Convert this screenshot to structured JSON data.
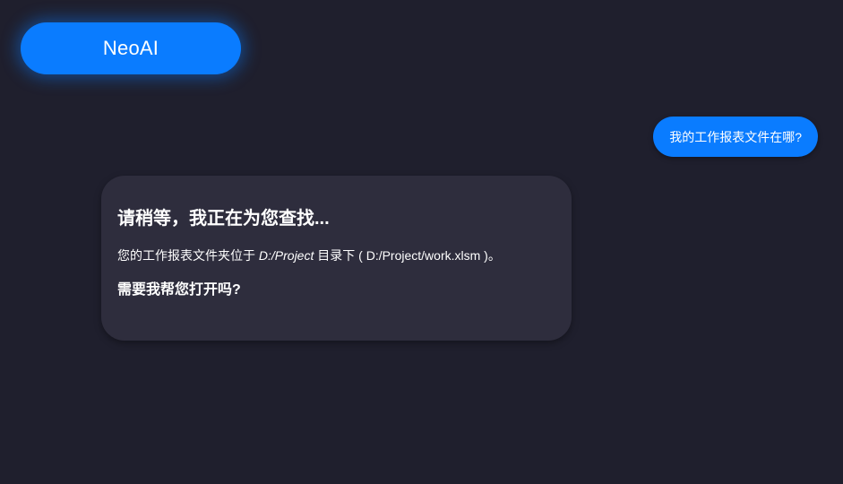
{
  "app": {
    "brand_button_label": "NeoAI"
  },
  "conversation": {
    "user_message": "我的工作报表文件在哪?",
    "assistant": {
      "title": "请稍等，我正在为您查找...",
      "answer_prefix": "您的工作报表文件夹位于 ",
      "folder_path": "D:/Project",
      "answer_middle": " 目录下 ( ",
      "file_path": "D:/Project/work.xlsm",
      "answer_suffix": " )。",
      "question": "需要我帮您打开吗?"
    }
  },
  "colors": {
    "background": "#1f1f2d",
    "accent": "#0a7cff",
    "assistant_bubble": "#2e2d3d",
    "text": "#ffffff"
  }
}
